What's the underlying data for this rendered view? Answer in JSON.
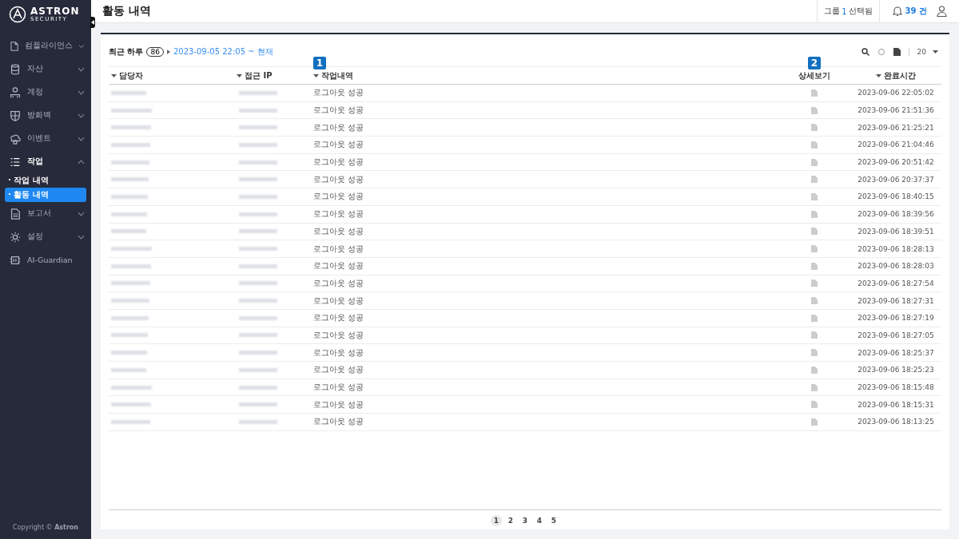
{
  "brand": {
    "name": "ASTRON",
    "tagline": "SECURITY"
  },
  "sidebar": {
    "items": [
      {
        "label": "컴플라이언스",
        "expanded": false,
        "has_caret": true
      },
      {
        "label": "자산",
        "expanded": false,
        "has_caret": true
      },
      {
        "label": "계정",
        "expanded": false,
        "has_caret": true
      },
      {
        "label": "방화벽",
        "expanded": false,
        "has_caret": true
      },
      {
        "label": "이벤트",
        "expanded": false,
        "has_caret": true
      },
      {
        "label": "작업",
        "expanded": true,
        "has_caret": true,
        "children": [
          {
            "label": "· 작업 내역",
            "selected": false
          },
          {
            "label": "· 활동 내역",
            "selected": true
          }
        ]
      },
      {
        "label": "보고서",
        "expanded": false,
        "has_caret": true
      },
      {
        "label": "설정",
        "expanded": false,
        "has_caret": true
      },
      {
        "label": "AI-Guardian",
        "expanded": false,
        "has_caret": false
      }
    ],
    "copyright": "Copyright © **Astron**"
  },
  "header": {
    "title": "활동 내역",
    "group_prefix": "그룹",
    "group_count": "1",
    "group_suffix": "선택됨",
    "notifications": "39 건"
  },
  "filter": {
    "label": "최근 하루",
    "count": "86",
    "range": "2023-09-05 22:05 ~ 현재",
    "page_size": "20"
  },
  "callouts": [
    "1",
    "2"
  ],
  "table": {
    "columns": [
      {
        "label": "담당자",
        "sortable": true
      },
      {
        "label": "접근 IP",
        "sortable": true
      },
      {
        "label": "작업내역",
        "sortable": true
      },
      {
        "label": "상세보기",
        "sortable": false
      },
      {
        "label": "완료시간",
        "sortable": true
      }
    ],
    "rows": [
      {
        "action": "로그아웃 성공",
        "time": "2023-09-06 22:05:02"
      },
      {
        "action": "로그아웃 성공",
        "time": "2023-09-06 21:51:36"
      },
      {
        "action": "로그아웃 성공",
        "time": "2023-09-06 21:25:21"
      },
      {
        "action": "로그아웃 성공",
        "time": "2023-09-06 21:04:46"
      },
      {
        "action": "로그아웃 성공",
        "time": "2023-09-06 20:51:42"
      },
      {
        "action": "로그아웃 성공",
        "time": "2023-09-06 20:37:37"
      },
      {
        "action": "로그아웃 성공",
        "time": "2023-09-06 18:40:15"
      },
      {
        "action": "로그아웃 성공",
        "time": "2023-09-06 18:39:56"
      },
      {
        "action": "로그아웃 성공",
        "time": "2023-09-06 18:39:51"
      },
      {
        "action": "로그아웃 성공",
        "time": "2023-09-06 18:28:13"
      },
      {
        "action": "로그아웃 성공",
        "time": "2023-09-06 18:28:03"
      },
      {
        "action": "로그아웃 성공",
        "time": "2023-09-06 18:27:54"
      },
      {
        "action": "로그아웃 성공",
        "time": "2023-09-06 18:27:31"
      },
      {
        "action": "로그아웃 성공",
        "time": "2023-09-06 18:27:19"
      },
      {
        "action": "로그아웃 성공",
        "time": "2023-09-06 18:27:05"
      },
      {
        "action": "로그아웃 성공",
        "time": "2023-09-06 18:25:37"
      },
      {
        "action": "로그아웃 성공",
        "time": "2023-09-06 18:25:23"
      },
      {
        "action": "로그아웃 성공",
        "time": "2023-09-06 18:15:48"
      },
      {
        "action": "로그아웃 성공",
        "time": "2023-09-06 18:15:31"
      },
      {
        "action": "로그아웃 성공",
        "time": "2023-09-06 18:13:25"
      }
    ]
  },
  "pagination": [
    {
      "label": "1",
      "selected": true
    },
    {
      "label": "2",
      "selected": false
    },
    {
      "label": "3",
      "selected": false
    },
    {
      "label": "4",
      "selected": false
    },
    {
      "label": "5",
      "selected": false
    }
  ]
}
